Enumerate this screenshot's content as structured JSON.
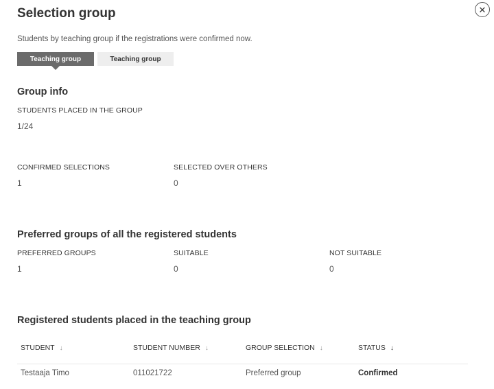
{
  "dialog": {
    "title": "Selection group",
    "close_symbol": "✕",
    "description": "Students by teaching group if the registrations were confirmed now."
  },
  "tabs": [
    {
      "label": "Teaching group",
      "active": true
    },
    {
      "label": "Teaching group",
      "active": false
    }
  ],
  "group_info": {
    "heading": "Group info",
    "placed_label": "STUDENTS PLACED IN THE GROUP",
    "placed_value": "1/24",
    "confirmed_label": "CONFIRMED SELECTIONS",
    "confirmed_value": "1",
    "over_label": "SELECTED OVER OTHERS",
    "over_value": "0"
  },
  "preferred": {
    "heading": "Preferred groups of all the registered students",
    "preferred_label": "PREFERRED GROUPS",
    "preferred_value": "1",
    "suitable_label": "SUITABLE",
    "suitable_value": "0",
    "not_suitable_label": "NOT SUITABLE",
    "not_suitable_value": "0"
  },
  "placed": {
    "heading": "Registered students placed in the teaching group",
    "columns": [
      "STUDENT",
      "STUDENT NUMBER",
      "GROUP SELECTION",
      "STATUS"
    ],
    "sort_symbol": "↓",
    "rows": [
      {
        "student": "Testaaja Timo",
        "number": "011021722",
        "selection": "Preferred group",
        "status": "Confirmed"
      }
    ]
  }
}
